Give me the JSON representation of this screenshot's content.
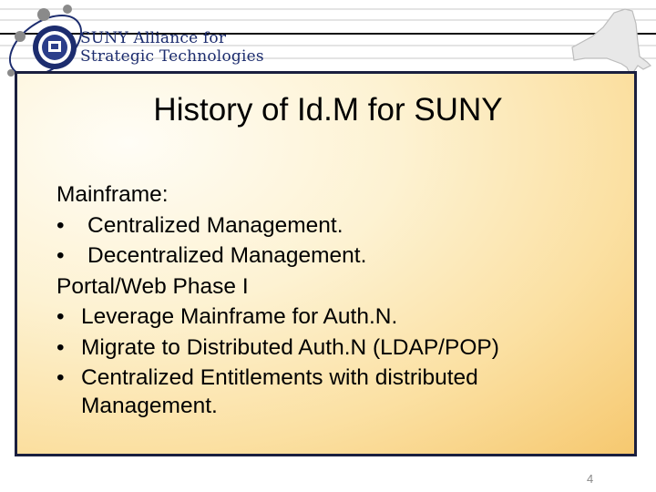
{
  "header": {
    "org_line1": "SUNY Alliance for",
    "org_line2": "Strategic Technologies",
    "logo_icon": "suny-seal-orbit-icon",
    "map_icon": "new-york-state-map-icon"
  },
  "slide": {
    "title": "History of Id.M for SUNY",
    "items": [
      {
        "text": "Mainframe:"
      },
      {
        "bullet": "•",
        "text": "Centralized Management."
      },
      {
        "bullet": "•",
        "text": "Decentralized Management."
      },
      {
        "text": "Portal/Web Phase I"
      },
      {
        "bullet": "•",
        "text": "Leverage Mainframe for Auth.N."
      },
      {
        "bullet": "•",
        "text": "Migrate to Distributed Auth.N (LDAP/POP)"
      },
      {
        "bullet": "•",
        "text": "Centralized Entitlements with distributed"
      },
      {
        "text": "Management."
      }
    ],
    "page_number": "4"
  },
  "colors": {
    "border": "#1a1f3f",
    "org_text": "#1c2c6e",
    "gradient_edge": "#f6c86f"
  }
}
